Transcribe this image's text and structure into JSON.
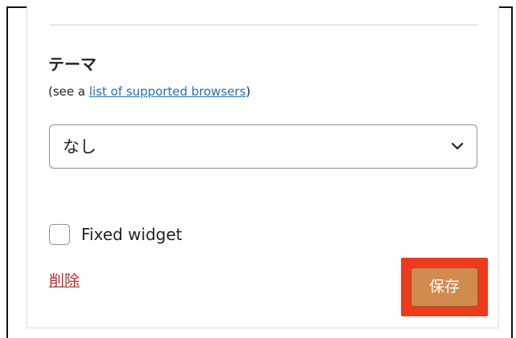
{
  "widget": {
    "theme_label": "テーマ",
    "help_prefix": "(see a ",
    "help_link": "list of supported browsers",
    "help_suffix": ")",
    "theme_select": {
      "selected": "なし",
      "icon": "chevron-down-icon"
    },
    "fixed_widget": {
      "label": "Fixed widget",
      "checked": false
    },
    "delete_label": "削除",
    "save_label": "保存"
  },
  "colors": {
    "link": "#2271b1",
    "delete": "#b32d2e",
    "save_button": "#d38a4f",
    "highlight": "#ee3a1c"
  }
}
